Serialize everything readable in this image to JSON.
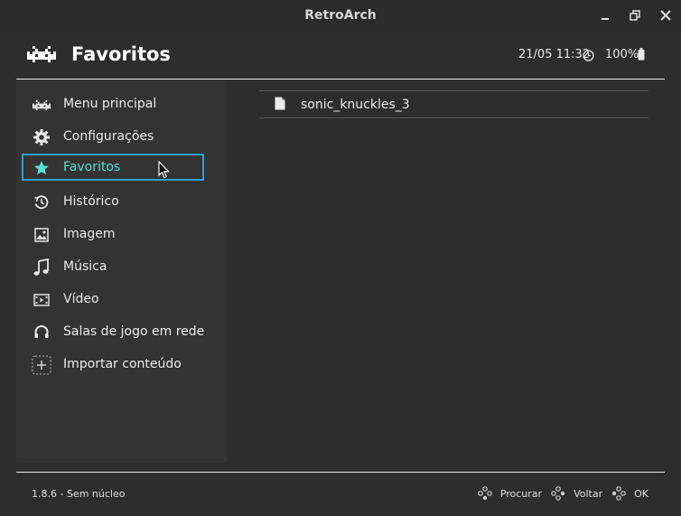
{
  "window": {
    "title": "RetroArch"
  },
  "header": {
    "title": "Favoritos",
    "datetime": "21/05 11:32",
    "battery": "100%"
  },
  "sidebar": {
    "items": [
      {
        "label": "Menu principal",
        "icon": "invader-icon"
      },
      {
        "label": "Configurações",
        "icon": "gear-icon"
      },
      {
        "label": "Favoritos",
        "icon": "star-icon",
        "active": true
      },
      {
        "label": "Histórico",
        "icon": "history-icon"
      },
      {
        "label": "Imagem",
        "icon": "image-icon"
      },
      {
        "label": "Música",
        "icon": "music-icon"
      },
      {
        "label": "Vídeo",
        "icon": "video-icon"
      },
      {
        "label": "Salas de jogo em rede",
        "icon": "netplay-icon"
      },
      {
        "label": "Importar conteúdo",
        "icon": "add-icon"
      }
    ]
  },
  "content": {
    "items": [
      {
        "label": "sonic_knuckles_3",
        "icon": "file-icon"
      }
    ]
  },
  "footer": {
    "version": "1.8.6 - Sem núcleo",
    "actions": [
      {
        "label": "Procurar",
        "icon": "gamepad-dpad-icon"
      },
      {
        "label": "Voltar",
        "icon": "gamepad-dpad-icon"
      },
      {
        "label": "OK",
        "icon": "gamepad-dpad-icon"
      }
    ]
  },
  "colors": {
    "accent": "#5ce0cf",
    "selection_border": "#2fa0c9",
    "background": "#2d2d2d",
    "sidebar": "#333333"
  }
}
